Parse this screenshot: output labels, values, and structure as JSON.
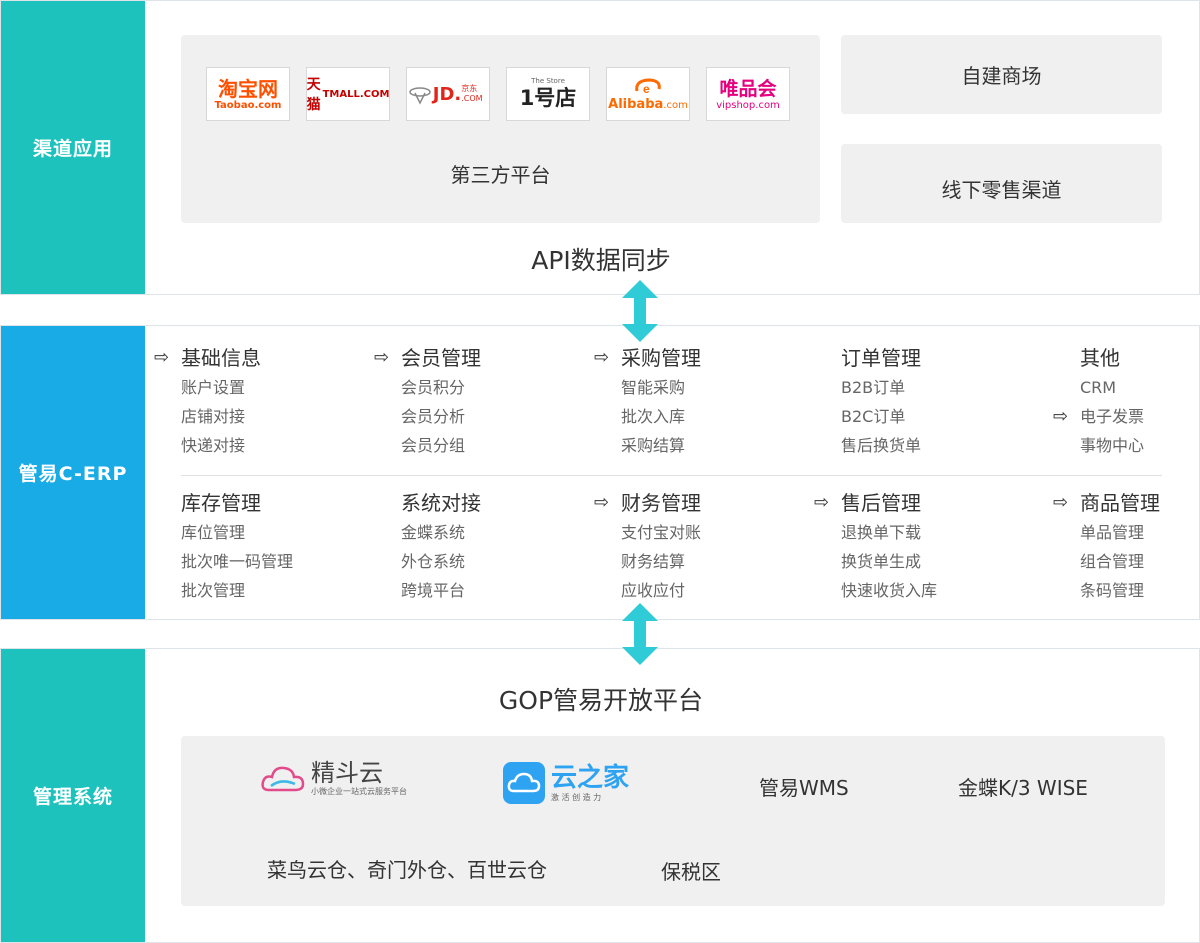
{
  "colors": {
    "teal": "#1ec2bd",
    "blue": "#19abe6",
    "arrow": "#2fcbd6"
  },
  "channel": {
    "side_label": "渠道应用",
    "logos": [
      {
        "name": "taobao",
        "main": "淘宝网",
        "sub": "Taobao.com"
      },
      {
        "name": "tmall",
        "main": "天猫",
        "sub": "TMALL.COM"
      },
      {
        "name": "jd",
        "main": "JD.",
        "sub": "京东 .COM"
      },
      {
        "name": "yhd",
        "main": "1号店",
        "sub": "The Store"
      },
      {
        "name": "alibaba",
        "main": "Alibaba",
        "sub": ".com"
      },
      {
        "name": "vip",
        "main": "唯品会",
        "sub": "vipshop.com"
      }
    ],
    "third_party_label": "第三方平台",
    "self_mall_label": "自建商场",
    "offline_label": "线下零售渠道",
    "api_label": "API数据同步"
  },
  "erp": {
    "side_label": "管易C-ERP",
    "rows": [
      [
        {
          "title": "基础信息",
          "arrow": true,
          "items": [
            {
              "text": "账户设置"
            },
            {
              "text": "店铺对接"
            },
            {
              "text": "快递对接"
            }
          ]
        },
        {
          "title": "会员管理",
          "arrow": true,
          "items": [
            {
              "text": "会员积分"
            },
            {
              "text": "会员分析"
            },
            {
              "text": "会员分组"
            }
          ]
        },
        {
          "title": "采购管理",
          "arrow": true,
          "items": [
            {
              "text": "智能采购"
            },
            {
              "text": "批次入库"
            },
            {
              "text": "采购结算"
            }
          ]
        },
        {
          "title": "订单管理",
          "arrow": false,
          "items": [
            {
              "text": "B2B订单"
            },
            {
              "text": "B2C订单"
            },
            {
              "text": "售后换货单"
            }
          ]
        },
        {
          "title": "其他",
          "arrow": false,
          "items": [
            {
              "text": "CRM"
            },
            {
              "text": "电子发票",
              "arrow": true
            },
            {
              "text": "事物中心"
            }
          ]
        }
      ],
      [
        {
          "title": "库存管理",
          "arrow": false,
          "items": [
            {
              "text": "库位管理"
            },
            {
              "text": "批次唯一码管理"
            },
            {
              "text": "批次管理"
            }
          ]
        },
        {
          "title": "系统对接",
          "arrow": false,
          "items": [
            {
              "text": "金蝶系统"
            },
            {
              "text": "外仓系统"
            },
            {
              "text": "跨境平台"
            }
          ]
        },
        {
          "title": "财务管理",
          "arrow": true,
          "items": [
            {
              "text": "支付宝对账"
            },
            {
              "text": "财务结算"
            },
            {
              "text": "应收应付"
            }
          ]
        },
        {
          "title": "售后管理",
          "arrow": true,
          "items": [
            {
              "text": "退换单下载"
            },
            {
              "text": "换货单生成"
            },
            {
              "text": "快速收货入库"
            }
          ]
        },
        {
          "title": "商品管理",
          "arrow": true,
          "items": [
            {
              "text": "单品管理"
            },
            {
              "text": "组合管理"
            },
            {
              "text": "条码管理"
            }
          ]
        }
      ]
    ]
  },
  "mgmt": {
    "side_label": "管理系统",
    "gop_label": "GOP管易开放平台",
    "jingdouyun": {
      "main": "精斗云",
      "sub": "小微企业一站式云服务平台"
    },
    "yunzhijia": {
      "main": "云之家",
      "sub": "激 活 创 造 力"
    },
    "wms_label": "管易WMS",
    "kingdee_label": "金蝶K/3 WISE",
    "cainiao_label": "菜鸟云仓、奇门外仓、百世云仓",
    "bonded_label": "保税区"
  }
}
